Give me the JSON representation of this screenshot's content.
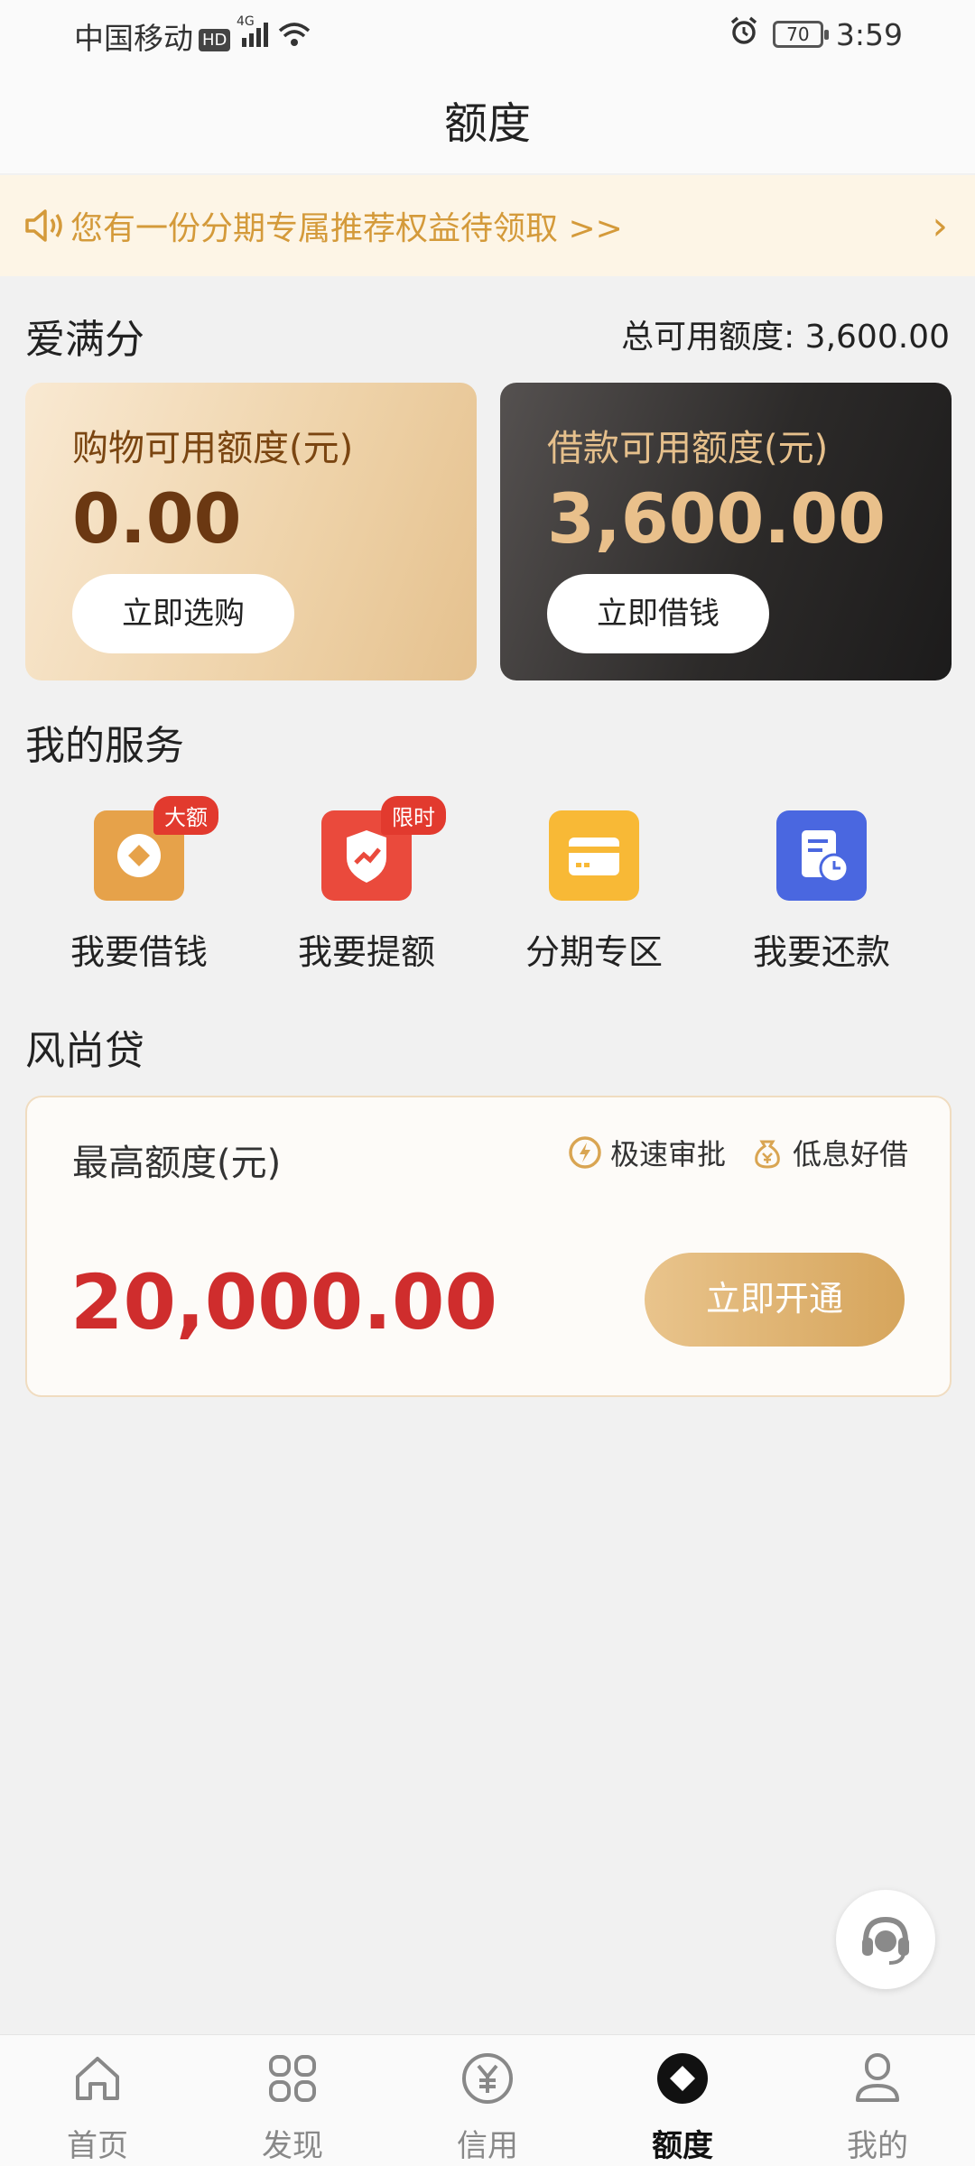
{
  "status": {
    "carrier": "中国移动",
    "hd": "HD",
    "network": "4G",
    "battery": "70",
    "time": "3:59"
  },
  "header": {
    "title": "额度"
  },
  "notice": {
    "text": "您有一份分期专属推荐权益待领取 >>",
    "arrow": "›"
  },
  "aimanfen": {
    "title": "爱满分",
    "total_label": "总可用额度: 3,600.00",
    "shop": {
      "label": "购物可用额度(元)",
      "amount": "0.00",
      "button": "立即选购"
    },
    "loan": {
      "label": "借款可用额度(元)",
      "amount": "3,600.00",
      "button": "立即借钱"
    }
  },
  "services": {
    "title": "我的服务",
    "items": [
      {
        "name": "我要借钱",
        "tag": "大额",
        "icon": "borrow-icon",
        "color": "#e6a24a"
      },
      {
        "name": "我要提额",
        "tag": "限时",
        "icon": "raise-limit-icon",
        "color": "#e8423a"
      },
      {
        "name": "分期专区",
        "tag": "",
        "icon": "installment-card-icon",
        "color": "#f8b936"
      },
      {
        "name": "我要还款",
        "tag": "",
        "icon": "repay-icon",
        "color": "#4a67e0"
      }
    ]
  },
  "fengshang": {
    "title": "风尚贷",
    "label": "最高额度(元)",
    "feature1": "极速审批",
    "feature2": "低息好借",
    "amount": "20,000.00",
    "button": "立即开通"
  },
  "tabs": [
    {
      "label": "首页",
      "icon": "home-icon"
    },
    {
      "label": "发现",
      "icon": "discover-icon"
    },
    {
      "label": "信用",
      "icon": "credit-icon"
    },
    {
      "label": "额度",
      "icon": "quota-icon",
      "active": true
    },
    {
      "label": "我的",
      "icon": "profile-icon"
    }
  ]
}
